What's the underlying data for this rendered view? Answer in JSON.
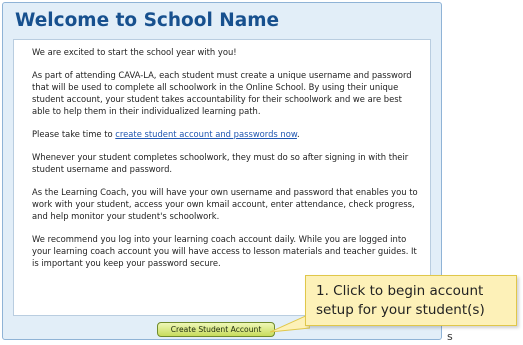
{
  "window": {
    "title": "Welcome to School Name"
  },
  "content": {
    "p1": "We are excited to start the school year with you!",
    "p2": "As part of attending CAVA-LA, each student must create a unique username and password that will be used to complete all schoolwork in the Online School. By using their unique student account, your student takes accountability for their schoolwork and we are best able to help them in their individualized learning path.",
    "p3_before": "Please take time to ",
    "p3_link": "create student account and passwords now",
    "p3_after": ".",
    "p4": "Whenever your student completes schoolwork, they must do so after signing in with their student username and password.",
    "p5": "As the Learning Coach, you will have your own username and password that enables you to work with your student, access your own kmail account, enter attendance, check progress, and help monitor your student's schoolwork.",
    "p6": "We recommend you log into your learning coach account daily. While you are logged into your learning coach account you will have access to lesson materials and teacher guides. It is important you keep your password secure."
  },
  "button": {
    "label": "Create Student Account"
  },
  "callout": {
    "line1": "1. Click to begin account",
    "line2": "setup for your student(s)"
  },
  "stray_text": "s",
  "colors": {
    "title": "#17508e",
    "panel": "#e2eef8",
    "button": "#c8dc5c",
    "callout": "#fdf1b8",
    "link": "#1f56b0"
  }
}
